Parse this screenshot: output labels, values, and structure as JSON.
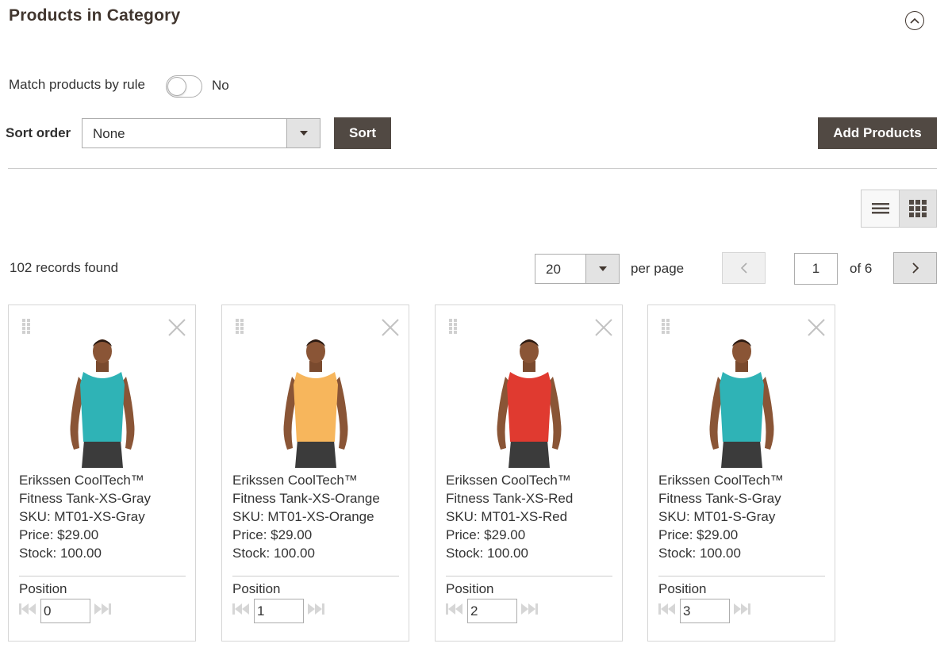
{
  "section": {
    "title": "Products in Category"
  },
  "match_rule": {
    "label": "Match products by rule",
    "state_text": "No"
  },
  "sort": {
    "label": "Sort order",
    "selected": "None",
    "button": "Sort"
  },
  "toolbar": {
    "add_products": "Add Products"
  },
  "grid": {
    "records_found": "102 records found",
    "per_page_value": "20",
    "per_page_label": "per page",
    "current_page": "1",
    "total_pages_text": "of 6"
  },
  "colors": {
    "dark_button": "#514943",
    "title": "#41362f"
  },
  "products": [
    {
      "name_line1": "Erikssen CoolTech™",
      "name_line2": "Fitness Tank-XS-Gray",
      "sku": "SKU: MT01-XS-Gray",
      "price": "Price: $29.00",
      "stock": "Stock: 100.00",
      "position_label": "Position",
      "position": "0",
      "shirt_color": "#2fb3b6"
    },
    {
      "name_line1": "Erikssen CoolTech™",
      "name_line2": "Fitness Tank-XS-Orange",
      "sku": "SKU: MT01-XS-Orange",
      "price": "Price: $29.00",
      "stock": "Stock: 100.00",
      "position_label": "Position",
      "position": "1",
      "shirt_color": "#f7b65c"
    },
    {
      "name_line1": "Erikssen CoolTech™",
      "name_line2": "Fitness Tank-XS-Red",
      "sku": "SKU: MT01-XS-Red",
      "price": "Price: $29.00",
      "stock": "Stock: 100.00",
      "position_label": "Position",
      "position": "2",
      "shirt_color": "#e03a30"
    },
    {
      "name_line1": "Erikssen CoolTech™",
      "name_line2": "Fitness Tank-S-Gray",
      "sku": "SKU: MT01-S-Gray",
      "price": "Price: $29.00",
      "stock": "Stock: 100.00",
      "position_label": "Position",
      "position": "3",
      "shirt_color": "#2fb3b6"
    }
  ]
}
